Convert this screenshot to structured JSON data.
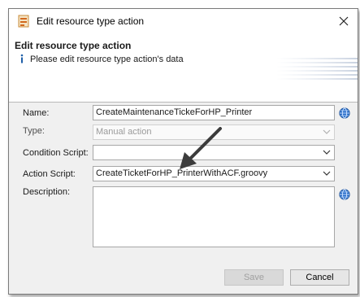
{
  "window": {
    "title": "Edit resource type action",
    "close_icon": "close-icon",
    "app_icon": "resource-action-icon"
  },
  "header": {
    "title": "Edit resource type action",
    "message": "Please edit resource type action's data",
    "info_icon": "info-icon"
  },
  "form": {
    "name_label": "Name:",
    "name_value": "CreateMaintenanceTickeForHP_Printer",
    "type_label": "Type:",
    "type_value": "Manual action",
    "condition_label": "Condition Script:",
    "condition_value": "",
    "action_label": "Action Script:",
    "action_value": "CreateTicketForHP_PrinterWithACF.groovy",
    "description_label": "Description:",
    "description_value": "",
    "translate_icon": "globe-icon"
  },
  "buttons": {
    "save_label": "Save",
    "cancel_label": "Cancel"
  },
  "colors": {
    "dialog_bg": "#f0f0f0",
    "globe_blue": "#2a6fc9",
    "arrow": "#3c3c3c"
  }
}
